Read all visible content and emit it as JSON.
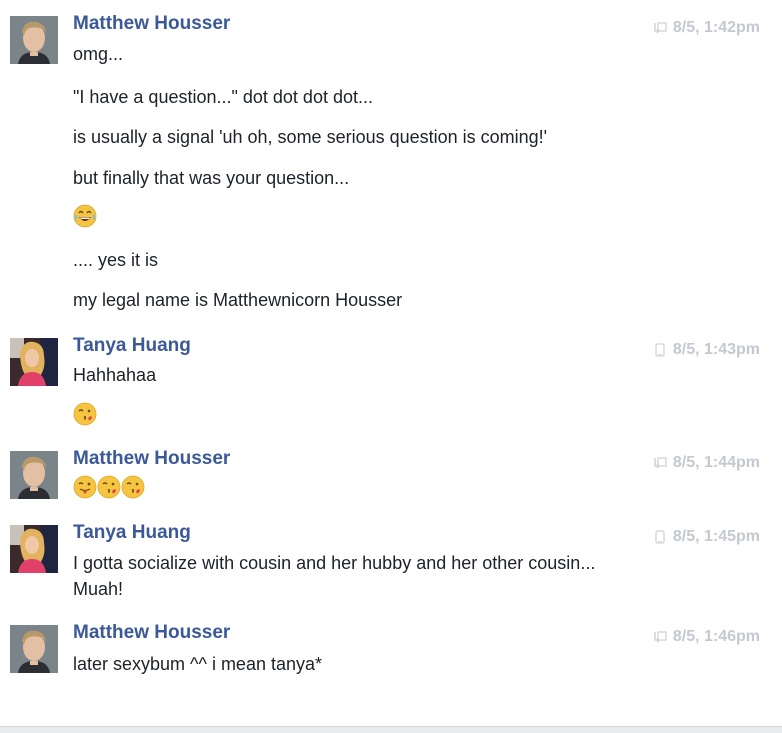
{
  "colors": {
    "author": "#3b5998",
    "text": "#1d2129",
    "timestamp": "#c4c8d0"
  },
  "messages": [
    {
      "author": "Matthew Housser",
      "timestamp": "8/5, 1:42pm",
      "lines": [
        "omg...",
        "\"I have a question...\" dot dot dot dot...",
        "is usually a signal 'uh oh, some serious question is coming!'",
        "but finally that was your question...",
        ".... yes it is",
        "my legal name is Matthewnicorn Housser"
      ],
      "emojis": [
        "face-with-tears-of-joy"
      ]
    },
    {
      "author": "Tanya Huang",
      "timestamp": "8/5, 1:43pm",
      "lines": [
        "Hahhahaa"
      ],
      "emojis": [
        "face-blowing-a-kiss"
      ]
    },
    {
      "author": "Matthew Housser",
      "timestamp": "8/5, 1:44pm",
      "lines": [],
      "emojis": [
        "face-with-tongue-winking",
        "face-blowing-a-kiss",
        "face-blowing-a-kiss"
      ]
    },
    {
      "author": "Tanya Huang",
      "timestamp": "8/5, 1:45pm",
      "lines": [
        "I gotta socialize with cousin and her hubby and her other cousin...",
        "Muah!"
      ],
      "emojis": []
    },
    {
      "author": "Matthew Housser",
      "timestamp": "8/5, 1:46pm",
      "lines": [
        "later sexybum ^^ i mean tanya*"
      ],
      "emojis": []
    }
  ]
}
